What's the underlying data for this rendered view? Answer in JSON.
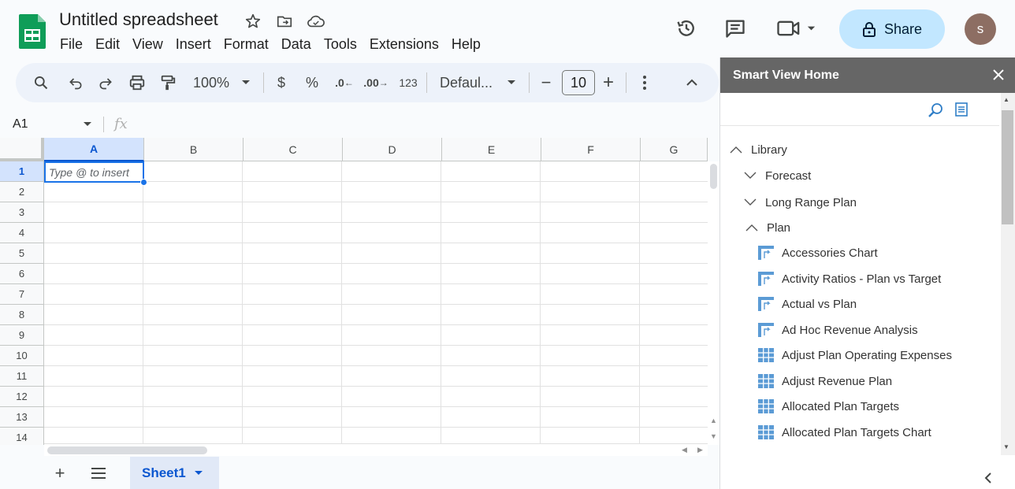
{
  "header": {
    "title": "Untitled spreadsheet",
    "menu": [
      "File",
      "Edit",
      "View",
      "Insert",
      "Format",
      "Data",
      "Tools",
      "Extensions",
      "Help"
    ],
    "share_label": "Share",
    "avatar_initial": "s"
  },
  "toolbar": {
    "zoom": "100%",
    "currency": "$",
    "percent": "%",
    "decrease_decimal": ".0",
    "increase_decimal": ".00",
    "number_format": "123",
    "font": "Defaul...",
    "font_size": "10",
    "minus": "−",
    "plus": "+"
  },
  "formula_bar": {
    "cell_ref": "A1",
    "fx": "fx"
  },
  "grid": {
    "columns": [
      "A",
      "B",
      "C",
      "D",
      "E",
      "F",
      "G"
    ],
    "rows": [
      "1",
      "2",
      "3",
      "4",
      "5",
      "6",
      "7",
      "8",
      "9",
      "10",
      "11",
      "12",
      "13",
      "14"
    ],
    "active_cell_placeholder": "Type @ to insert"
  },
  "sheets": {
    "active": "Sheet1"
  },
  "panel": {
    "title": "Smart View Home",
    "tree": {
      "root": "Library",
      "folders": [
        "Forecast",
        "Long Range Plan",
        "Plan"
      ],
      "items": [
        {
          "label": "Accessories Chart",
          "icon": "chart-icon"
        },
        {
          "label": "Activity Ratios - Plan vs Target",
          "icon": "chart-icon"
        },
        {
          "label": "Actual vs Plan",
          "icon": "chart-icon"
        },
        {
          "label": "Ad Hoc Revenue Analysis",
          "icon": "chart-icon"
        },
        {
          "label": "Adjust Plan Operating Expenses",
          "icon": "grid-icon"
        },
        {
          "label": "Adjust Revenue Plan",
          "icon": "grid-icon"
        },
        {
          "label": "Allocated Plan Targets",
          "icon": "grid-icon"
        },
        {
          "label": "Allocated Plan Targets Chart",
          "icon": "grid-icon"
        }
      ]
    }
  },
  "colors": {
    "accent": "#0b57d0",
    "share_bg": "#c2e7ff",
    "panel_header": "#666666",
    "sheets_green": "#0f9d58"
  }
}
